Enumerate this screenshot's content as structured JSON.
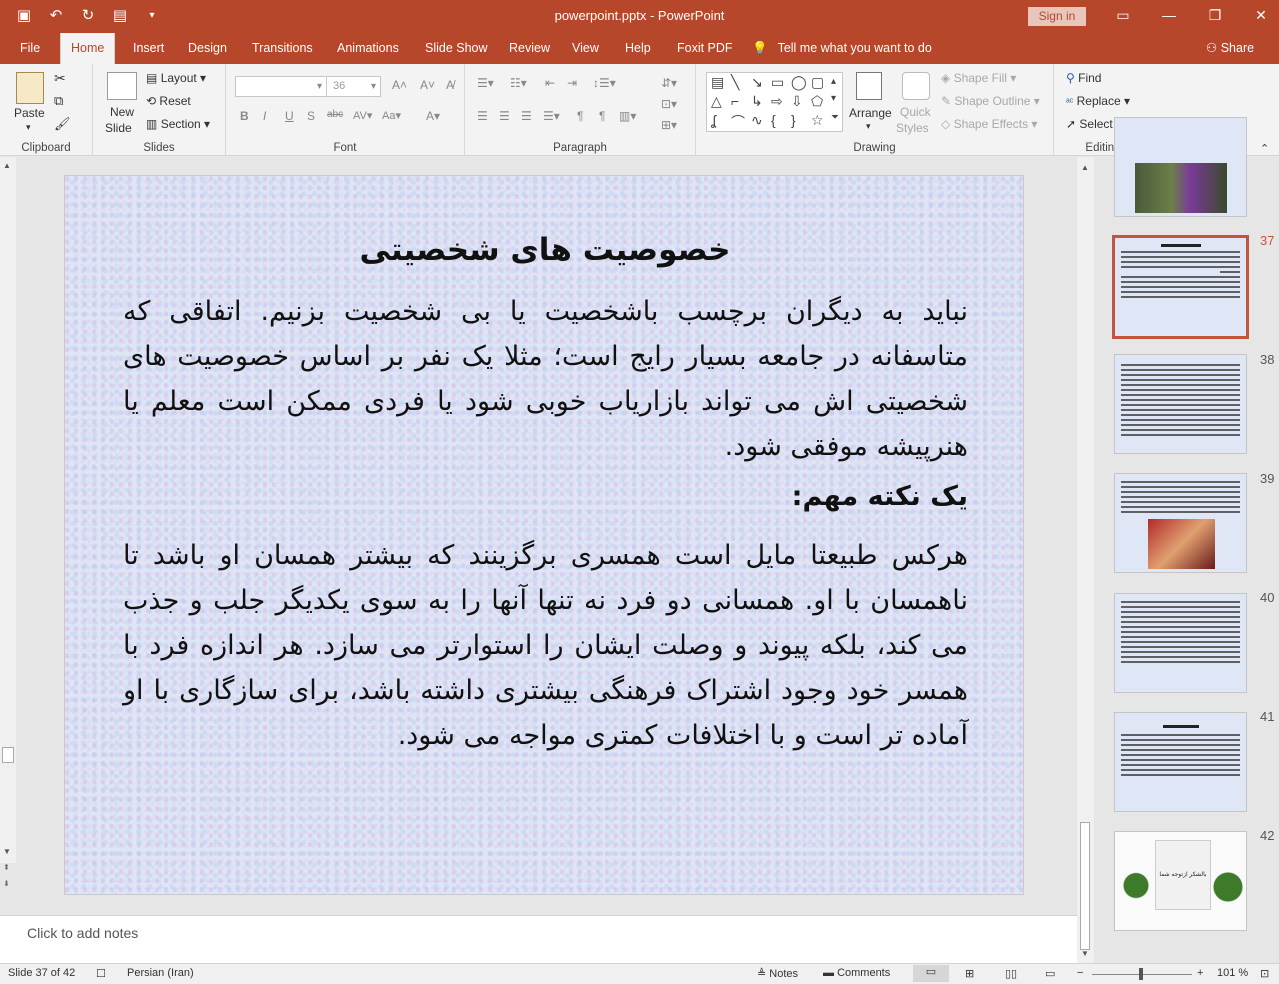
{
  "window": {
    "title": "powerpoint.pptx - PowerPoint",
    "signin_label": "Sign in"
  },
  "tabs": [
    "File",
    "Home",
    "Insert",
    "Design",
    "Transitions",
    "Animations",
    "Slide Show",
    "Review",
    "View",
    "Help",
    "Foxit PDF"
  ],
  "active_tab": "Home",
  "tell_me": "Tell me what you want to do",
  "share_label": "Share",
  "ribbon": {
    "clipboard": {
      "label": "Clipboard",
      "paste": "Paste"
    },
    "slides": {
      "label": "Slides",
      "new_slide_1": "New",
      "new_slide_2": "Slide",
      "layout": "Layout",
      "reset": "Reset",
      "section": "Section"
    },
    "font": {
      "label": "Font",
      "size": "36"
    },
    "paragraph": {
      "label": "Paragraph"
    },
    "drawing": {
      "label": "Drawing",
      "arrange": "Arrange",
      "quick_styles_1": "Quick",
      "quick_styles_2": "Styles",
      "shape_fill": "Shape Fill",
      "shape_outline": "Shape Outline",
      "shape_effects": "Shape Effects"
    },
    "editing": {
      "label": "Editing",
      "find": "Find",
      "replace": "Replace",
      "select": "Select"
    }
  },
  "slide": {
    "title": "خصوصیت های شخصیتی",
    "para1": "نباید به دیگران برچسب باشخصیت یا بی شخصیت بزنیم. اتفاقی که متاسفانه در جامعه بسیار رایج است؛ مثلا یک نفر بر اساس خصوصیت های شخصیتی اش می تواند بازاریاب خوبی شود یا فردی ممکن است معلم یا هنرپیشه موفقی شود.",
    "subheading": "یک نکته مهم:",
    "para2": "هرکس طبیعتا مایل است همسری برگزینند که بیشتر همسان او باشد تا ناهمسان با او. همسانی دو فرد نه تنها آنها را به سوی یکدیگر جلب و جذب می کند، بلکه پیوند و وصلت ایشان را استوارتر می سازد. هر اندازه فرد با همسر خود وجود اشتراک فرهنگی بیشتری داشته باشد، برای سازگاری با او آماده تر است و با اختلافات کمتری مواجه می شود."
  },
  "thumbnails": [
    {
      "num": "",
      "kind": "photo-couple"
    },
    {
      "num": "37",
      "kind": "text",
      "active": true
    },
    {
      "num": "38",
      "kind": "text"
    },
    {
      "num": "39",
      "kind": "text-photo"
    },
    {
      "num": "40",
      "kind": "text"
    },
    {
      "num": "41",
      "kind": "text"
    },
    {
      "num": "42",
      "kind": "plants",
      "caption": "بالشکر ازتوجه شما"
    }
  ],
  "notes_placeholder": "Click to add notes",
  "status": {
    "slide_info": "Slide 37 of 42",
    "language": "Persian (Iran)",
    "notes": "Notes",
    "comments": "Comments",
    "zoom": "101 %"
  }
}
